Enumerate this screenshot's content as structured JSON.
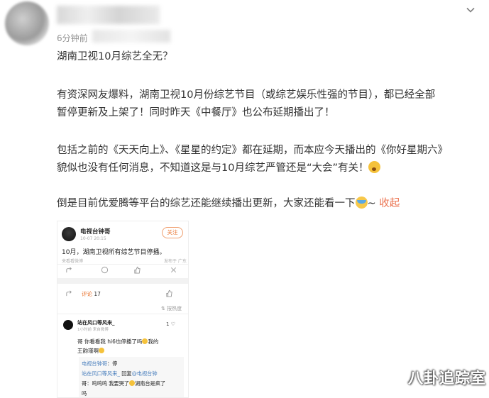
{
  "post": {
    "time_ago": "6分钟前",
    "title": "湖南卫视10月综艺全无？",
    "para1": "有资深网友爆料，湖南卫视10月份综艺节目（或综艺娱乐性强的节目），都已经全部暂停更新及上架了！同时昨天《中餐厅》也公布延期播出了！",
    "para2": "包括之前的《天天向上》、《星星的约定》都在延期，而本应今天播出的《你好星期六》貌似也没有任何消息，不知道这是与10月综艺严管还是“大会”有关！",
    "para3": "倒是目前优爱腾等平台的综艺还能继续播出更新，大家还能看一下",
    "para3_tail": "~ ",
    "collapse_label": "收起",
    "emoji_icons": [
      "surprised-emoji-icon",
      "crying-emoji-icon"
    ]
  },
  "embedded": {
    "account_name": "电视台钟哥",
    "post_date": "10-07 20:15",
    "follow_label": "关注",
    "text": "10月，湖南卫视所有综艺节目停播。",
    "subline": "来看看微博",
    "location": "发布于 广东",
    "comments_label": "评论",
    "comments_count": "17",
    "sort_label": "按热度",
    "commenter": {
      "name": "站在风口等风来_",
      "meta": "1小时前  来自微博",
      "likes": "1",
      "text": "哥 你看看我 hi6也停播了吗",
      "text2": "我的",
      "text3": "王韵瑾啊"
    },
    "reply": {
      "line1_name": "电视台钟哥",
      "line1_text": "：停",
      "line2_name": "站在风口等风来_",
      "line2_text": " 回复",
      "line2_name2": "@电视台钟",
      "line3": "哥：呜呜呜 我要哭了",
      "line3b": "湖南台是疯了",
      "line4": "吗"
    }
  },
  "watermark": "八卦追踪室"
}
